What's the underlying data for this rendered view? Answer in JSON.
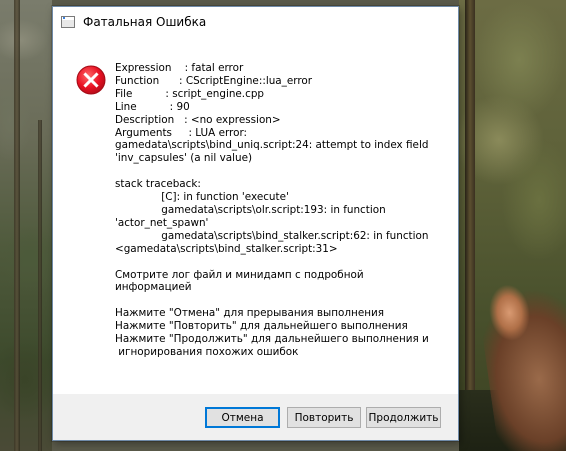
{
  "dialog": {
    "title": "Фатальная Ошибка",
    "message": "Expression    : fatal error\nFunction      : CScriptEngine::lua_error\nFile          : script_engine.cpp\nLine          : 90\nDescription   : <no expression>\nArguments     : LUA error:\ngamedata\\scripts\\bind_uniq.script:24: attempt to index field\n'inv_capsules' (a nil value)\n\nstack traceback:\n              [C]: in function 'execute'\n              gamedata\\scripts\\olr.script:193: in function\n'actor_net_spawn'\n              gamedata\\scripts\\bind_stalker.script:62: in function\n<gamedata\\scripts\\bind_stalker.script:31>\n\nСмотрите лог файл и минидамп с подробной\nинформацией\n\nНажмите \"Отмена\" для прерывания выполнения\nНажмите \"Повторить\" для дальнейшего выполнения\nНажмите \"Продолжить\" для дальнейшего выполнения и\n игнорирования похожих ошибок",
    "icon": "error-icon",
    "error_color": "#e81123"
  },
  "buttons": {
    "cancel_label": "Отмена",
    "retry_label": "Повторить",
    "continue_label": "Продолжить"
  }
}
